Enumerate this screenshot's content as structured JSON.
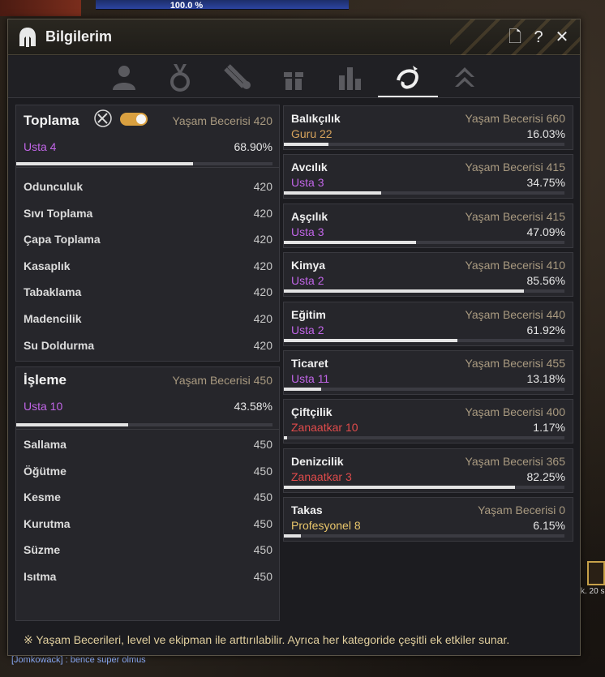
{
  "background": {
    "hp_text": "100.0 %",
    "chat_line": "[Jomkowack] : bence super olmus",
    "slot_text": "k. 20 s"
  },
  "window": {
    "title": "Bilgilerim",
    "buttons": {
      "doc": "🗋",
      "help": "?",
      "close": "✕"
    }
  },
  "tabs": [
    {
      "name": "profile",
      "icon": "person-icon",
      "active": false
    },
    {
      "name": "medal",
      "icon": "medal-icon",
      "active": false
    },
    {
      "name": "scroll",
      "icon": "scroll-icon",
      "active": false
    },
    {
      "name": "gift",
      "icon": "gift-icon",
      "active": false
    },
    {
      "name": "stats",
      "icon": "bar-chart-icon",
      "active": false
    },
    {
      "name": "life-skills",
      "icon": "fishing-hook-icon",
      "active": true
    },
    {
      "name": "rank",
      "icon": "double-chevron-up-icon",
      "active": false
    }
  ],
  "gathering": {
    "title": "Toplama",
    "skill_label": "Yaşam Becerisi 420",
    "rank": "Usta 4",
    "percent": "68.90%",
    "progress": 0.689,
    "items": [
      {
        "name": "Odunculuk",
        "value": "420"
      },
      {
        "name": "Sıvı Toplama",
        "value": "420"
      },
      {
        "name": "Çapa Toplama",
        "value": "420"
      },
      {
        "name": "Kasaplık",
        "value": "420"
      },
      {
        "name": "Tabaklama",
        "value": "420"
      },
      {
        "name": "Madencilik",
        "value": "420"
      },
      {
        "name": "Su Doldurma",
        "value": "420"
      }
    ]
  },
  "processing": {
    "title": "İşleme",
    "skill_label": "Yaşam Becerisi 450",
    "rank": "Usta 10",
    "percent": "43.58%",
    "progress": 0.4358,
    "items": [
      {
        "name": "Sallama",
        "value": "450"
      },
      {
        "name": "Öğütme",
        "value": "450"
      },
      {
        "name": "Kesme",
        "value": "450"
      },
      {
        "name": "Kurutma",
        "value": "450"
      },
      {
        "name": "Süzme",
        "value": "450"
      },
      {
        "name": "Isıtma",
        "value": "450"
      }
    ]
  },
  "skills": [
    {
      "name": "Balıkçılık",
      "rank_title": "Guru",
      "rank_num": "22",
      "rank_color": "orange",
      "skill_label": "Yaşam Becerisi 660",
      "percent": "16.03%",
      "progress": 0.1603
    },
    {
      "name": "Avcılık",
      "rank_title": "Usta",
      "rank_num": "3",
      "rank_color": "purple",
      "skill_label": "Yaşam Becerisi 415",
      "percent": "34.75%",
      "progress": 0.3475
    },
    {
      "name": "Aşçılık",
      "rank_title": "Usta",
      "rank_num": "3",
      "rank_color": "purple",
      "skill_label": "Yaşam Becerisi 415",
      "percent": "47.09%",
      "progress": 0.4709
    },
    {
      "name": "Kimya",
      "rank_title": "Usta",
      "rank_num": "2",
      "rank_color": "purple",
      "skill_label": "Yaşam Becerisi 410",
      "percent": "85.56%",
      "progress": 0.8556
    },
    {
      "name": "Eğitim",
      "rank_title": "Usta",
      "rank_num": "2",
      "rank_color": "purple",
      "skill_label": "Yaşam Becerisi 440",
      "percent": "61.92%",
      "progress": 0.6192
    },
    {
      "name": "Ticaret",
      "rank_title": "Usta",
      "rank_num": "11",
      "rank_color": "purple",
      "skill_label": "Yaşam Becerisi 455",
      "percent": "13.18%",
      "progress": 0.1318
    },
    {
      "name": "Çiftçilik",
      "rank_title": "Zanaatkar",
      "rank_num": "10",
      "rank_color": "red",
      "skill_label": "Yaşam Becerisi 400",
      "percent": "1.17%",
      "progress": 0.0117
    },
    {
      "name": "Denizcilik",
      "rank_title": "Zanaatkar",
      "rank_num": "3",
      "rank_color": "red",
      "skill_label": "Yaşam Becerisi 365",
      "percent": "82.25%",
      "progress": 0.8225
    },
    {
      "name": "Takas",
      "rank_title": "Profesyonel",
      "rank_num": "8",
      "rank_color": "gold",
      "skill_label": "Yaşam Becerisi 0",
      "percent": "6.15%",
      "progress": 0.0615
    }
  ],
  "footer": "※ Yaşam Becerileri, level ve ekipman ile arttırılabilir. Ayrıca her kategoride çeşitli ek etkiler sunar.",
  "colors": {
    "purple": "#c065e6",
    "orange": "#d7a35c",
    "red": "#e04b4b",
    "gold": "#e9c66b",
    "muted": "#a99a80"
  }
}
